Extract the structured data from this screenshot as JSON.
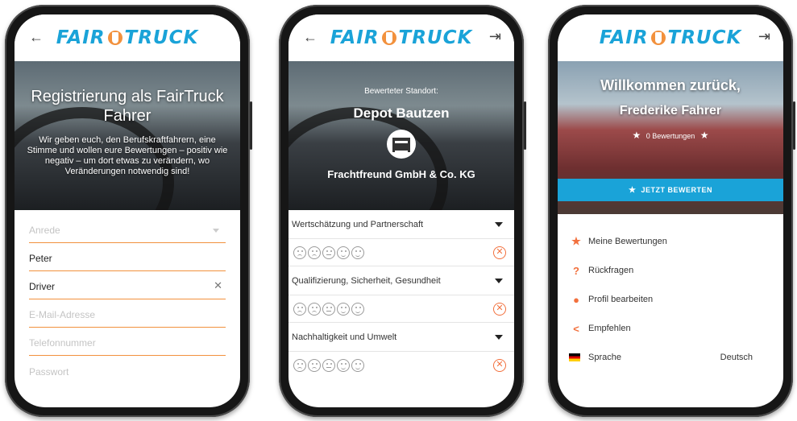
{
  "brand": {
    "name_left": "FAIR",
    "name_right": "TRUCK",
    "color": "#1aa3d8",
    "accent": "#f2913d"
  },
  "screen1": {
    "hero_title": "Registrierung als FairTruck Fahrer",
    "hero_text": "Wir geben euch, den Berufskraftfahrern, eine Stimme und wollen eure Bewertungen – positiv wie negativ – um dort etwas zu verändern, wo Veränderungen notwendig sind!",
    "fields": [
      {
        "value": "Anrede",
        "placeholder": true
      },
      {
        "value": "Peter",
        "placeholder": false
      },
      {
        "value": "Driver",
        "placeholder": false
      },
      {
        "value": "E-Mail-Adresse",
        "placeholder": true
      },
      {
        "value": "Telefonnummer",
        "placeholder": true
      },
      {
        "value": "Passwort",
        "placeholder": true
      }
    ]
  },
  "screen2": {
    "location_label": "Bewerteter Standort:",
    "location_name": "Depot Bautzen",
    "company": "Frachtfreund GmbH & Co. KG",
    "categories": [
      "Wertschätzung und Partnerschaft",
      "Qualifizierung, Sicherheit, Gesundheit",
      "Nachhaltigkeit und Umwelt"
    ]
  },
  "screen3": {
    "welcome": "Willkommen zurück,",
    "name": "Frederike Fahrer",
    "ratings": "0 Bewertungen",
    "cta": "JETZT BEWERTEN",
    "menu": [
      {
        "icon": "star-icon",
        "label": "Meine Bewertungen"
      },
      {
        "icon": "question-icon",
        "label": "Rückfragen"
      },
      {
        "icon": "person-icon",
        "label": "Profil bearbeiten"
      },
      {
        "icon": "share-icon",
        "label": "Empfehlen"
      }
    ],
    "language_label": "Sprache",
    "language_value": "Deutsch"
  }
}
